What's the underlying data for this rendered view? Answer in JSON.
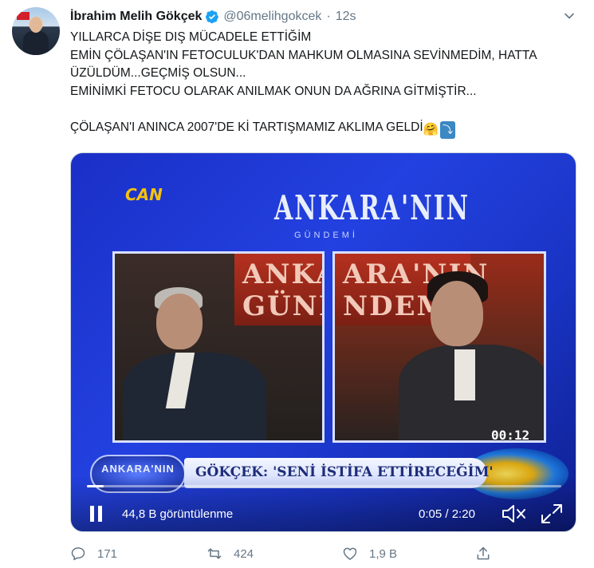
{
  "user": {
    "name": "İbrahim Melih Gökçek",
    "handle": "@06melihgokcek",
    "time": "12s",
    "separator": "·"
  },
  "tweet": {
    "text": "YILLARCA DİŞE DIŞ MÜCADELE ETTİĞİM\nEMİN ÇÖLAŞAN'IN FETOCULUK'DAN MAHKUM OLMASINA SEVİNMEDİM, HATTA ÜZÜLDÜM...GEÇMİŞ OLSUN...\nEMİNİMKİ FETOCU OLARAK ANILMAK ONUN DA AĞRINA GİTMİŞTİR...\n\nÇÖLAŞAN'I ANINCA 2007'DE Kİ TARTIŞMAMIZ AKLIMA GELDİ",
    "emoji_hug": "🤗",
    "emoji_arrow": "⤵"
  },
  "video": {
    "channel_logo": "CAN",
    "show_title": "ANKARA'NIN",
    "show_subtitle": "GÜNDEMİ",
    "left_banner": "ANKARA GÜNDE",
    "right_banner": "ARA'NIN NDEMİ",
    "overlay_time": "00:12",
    "lower_third_logo": "ANKARA'NIN",
    "lower_third_text": "GÖKÇEK: 'SENİ İSTİFA ETTİRECEĞİM'",
    "views": "44,8 B görüntülenme",
    "current_time": "0:05",
    "duration": "2:20",
    "time_separator": " / ",
    "progress": 0.036
  },
  "actions": {
    "replies": "171",
    "retweets": "424",
    "likes": "1,9 B"
  },
  "colors": {
    "verified": "#1da1f2",
    "secondary_text": "#657786",
    "primary_text": "#14171a"
  }
}
